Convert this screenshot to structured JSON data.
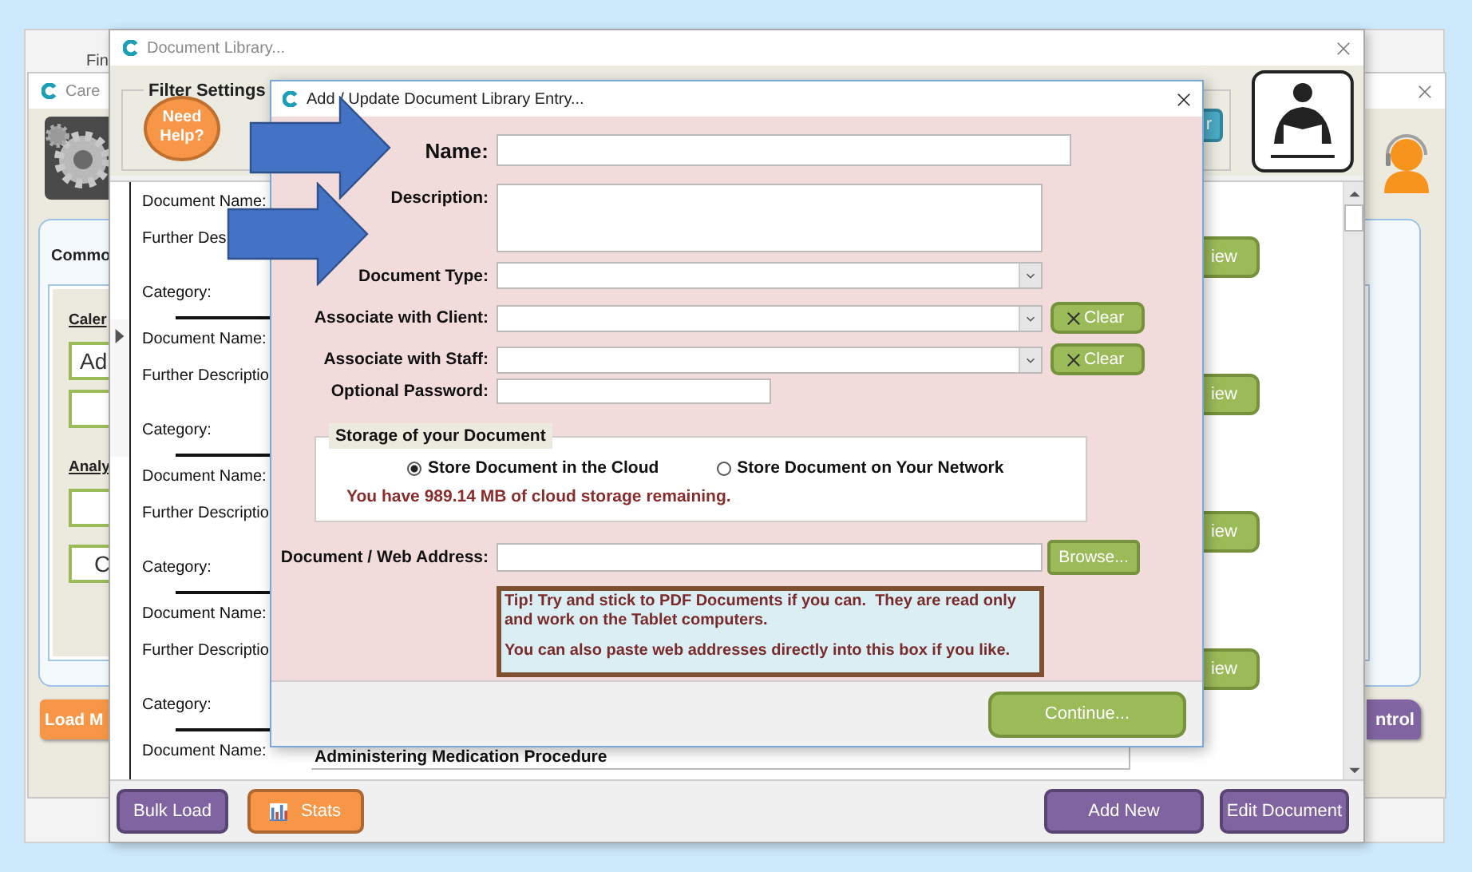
{
  "desktop_window": {
    "toolbar_label": "Fin"
  },
  "main_window": {
    "title": "Care",
    "panel_heading": "Commo",
    "sections": [
      {
        "heading": "Caler",
        "tiles": [
          {
            "kind": "tile",
            "label": "Ad"
          },
          {
            "kind": "tile"
          }
        ]
      },
      {
        "heading": "Analy",
        "tiles": [
          {
            "kind": "tile"
          },
          {
            "kind": "tile",
            "label": "C"
          }
        ]
      }
    ],
    "footer_buttons": [
      {
        "label": "Load M",
        "color": "#f79646"
      },
      {
        "label": "ntrol",
        "color": "#8064a2"
      }
    ]
  },
  "library_window": {
    "title": "Document Library...",
    "filter": {
      "legend": "Filter Settings",
      "help_button": "Need Help?",
      "search_button": "r"
    },
    "records": [
      {
        "name_label": "Document Name:",
        "description_label": "Further Des",
        "category_label": "Category:",
        "view_button": "iew",
        "current": false
      },
      {
        "name_label": "Document Name:",
        "description_label": "Further Descriptio",
        "category_label": "Category:",
        "view_button": "iew",
        "current": true
      },
      {
        "name_label": "Document Name:",
        "description_label": "Further Descriptio",
        "category_label": "Category:",
        "view_button": "iew",
        "current": false
      },
      {
        "name_label": "Document Name:",
        "description_label": "Further Descriptio",
        "category_label": "Category:",
        "view_button": "iew",
        "current": false
      },
      {
        "name_label": "Document Name:",
        "name_value": "Administering Medication Procedure",
        "current": false
      }
    ],
    "left_buttons": [
      {
        "label": "Bulk Load",
        "color": "#8064a2"
      },
      {
        "label": "Stats",
        "color": "#f79646",
        "kind": "chart"
      }
    ],
    "right_buttons": [
      {
        "label": "Add New",
        "color": "#8064a2"
      },
      {
        "label": "Edit Document",
        "color": "#8064a2"
      }
    ]
  },
  "dialog": {
    "title": "Add / Update Document Library Entry...",
    "fields": [
      {
        "kind": "text",
        "label": "Name:"
      },
      {
        "kind": "textarea",
        "label": "Description:"
      },
      {
        "kind": "select",
        "label": "Document Type:"
      },
      {
        "kind": "select",
        "label": "Associate with Client:",
        "button": "Clear"
      },
      {
        "kind": "select",
        "label": "Associate with Staff:",
        "button": "Clear"
      },
      {
        "kind": "password",
        "label": "Optional Password:"
      }
    ],
    "storage": {
      "legend": "Storage of your Document",
      "options": [
        {
          "label": "Store Document in the Cloud",
          "selected": true
        },
        {
          "label": "Store Document on Your Network",
          "selected": false
        }
      ],
      "note": "You have 989.14 MB of cloud storage remaining."
    },
    "address": {
      "label": "Document / Web Address:",
      "button": "Browse..."
    },
    "tip": [
      "Tip! Try and stick to PDF Documents if you can.  They are read only and work on the Tablet computers.",
      "You can also paste web addresses directly into this box if you like."
    ],
    "continue_button": "Continue..."
  },
  "callout_arrows": [
    {
      "kind": "arrow"
    },
    {
      "kind": "arrow"
    }
  ]
}
